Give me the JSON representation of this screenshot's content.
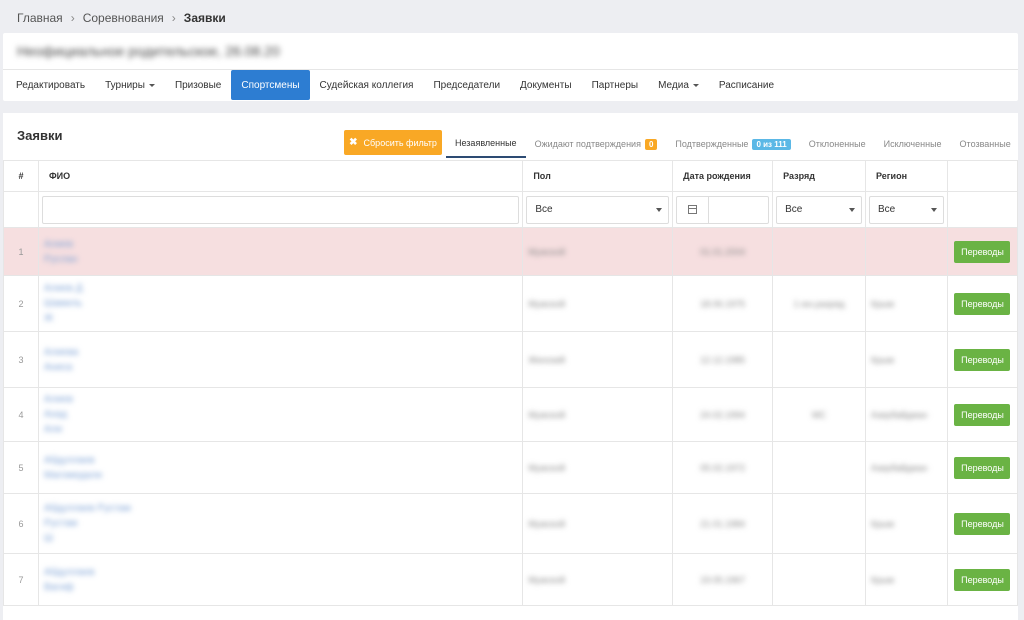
{
  "breadcrumbs": [
    "Главная",
    "Соревнования",
    "Заявки"
  ],
  "event": {
    "title": "Неофициальное родительское, 26.08.20"
  },
  "nav": [
    {
      "label": "Редактировать",
      "dropdown": false,
      "active": false
    },
    {
      "label": "Турниры",
      "dropdown": true,
      "active": false
    },
    {
      "label": "Призовые",
      "dropdown": false,
      "active": false
    },
    {
      "label": "Спортсмены",
      "dropdown": false,
      "active": true
    },
    {
      "label": "Судейская коллегия",
      "dropdown": false,
      "active": false
    },
    {
      "label": "Председатели",
      "dropdown": false,
      "active": false
    },
    {
      "label": "Документы",
      "dropdown": false,
      "active": false
    },
    {
      "label": "Партнеры",
      "dropdown": false,
      "active": false
    },
    {
      "label": "Медиа",
      "dropdown": true,
      "active": false
    },
    {
      "label": "Расписание",
      "dropdown": false,
      "active": false
    }
  ],
  "main": {
    "title": "Заявки",
    "reset_filter_label": "Сбросить фильтр",
    "status_tabs": [
      {
        "label": "Незаявленные",
        "active": true,
        "badge": ""
      },
      {
        "label": "Ожидают подтверждения",
        "active": false,
        "badge": "0",
        "badge_color": "orange"
      },
      {
        "label": "Подтвержденные",
        "active": false,
        "badge": "0 из 111",
        "badge_color": "blue"
      },
      {
        "label": "Отклоненные",
        "active": false,
        "badge": ""
      },
      {
        "label": "Исключенные",
        "active": false,
        "badge": ""
      },
      {
        "label": "Отозванные",
        "active": false,
        "badge": ""
      }
    ]
  },
  "table": {
    "headers": {
      "num": "#",
      "fio": "ФИО",
      "gender": "Пол",
      "birth": "Дата рождения",
      "rank": "Разряд",
      "region": "Регион"
    },
    "filters": {
      "fio_value": "",
      "gender": "Все",
      "birth_value": "",
      "rank": "Все",
      "region": "Все"
    },
    "action_label": "Переводы",
    "colors": {
      "highlight": "#f6dfe0",
      "action": "#6ab344",
      "active_tab": "#2d7dd2",
      "reset": "#f9a825"
    },
    "rows": [
      {
        "num": "1",
        "names": [
          "Алиев",
          "Руслан"
        ],
        "gender": "Мужской",
        "birth": "01.01.2004",
        "rank": "",
        "region": "",
        "highlight": true
      },
      {
        "num": "2",
        "names": [
          "Алиев Д",
          "Шамиль",
          "Ж"
        ],
        "gender": "Мужской",
        "birth": "18.06.1975",
        "rank": "1 юн.разряд",
        "region": "Крым",
        "highlight": false
      },
      {
        "num": "3",
        "names": [
          "Алиева",
          "Аниса"
        ],
        "gender": "Женский",
        "birth": "12.12.1985",
        "rank": "",
        "region": "Крым",
        "highlight": false
      },
      {
        "num": "4",
        "names": [
          "Алиев",
          "Ахад",
          "Али"
        ],
        "gender": "Мужской",
        "birth": "24.02.1994",
        "rank": "МС",
        "region": "Азербайджан",
        "highlight": false
      },
      {
        "num": "5",
        "names": [
          "Абдуллаев",
          "Магомедали"
        ],
        "gender": "Мужской",
        "birth": "05.02.1972",
        "rank": "",
        "region": "Азербайджан",
        "highlight": false
      },
      {
        "num": "6",
        "names": [
          "Абдуллаев Рустам",
          "Рустам",
          "Ш"
        ],
        "gender": "Мужской",
        "birth": "21.01.1984",
        "rank": "",
        "region": "Крым",
        "highlight": false
      },
      {
        "num": "7",
        "names": [
          "Абдуллаев",
          "Вагиф"
        ],
        "gender": "Мужской",
        "birth": "19.05.1967",
        "rank": "",
        "region": "Крым",
        "highlight": false
      }
    ]
  }
}
